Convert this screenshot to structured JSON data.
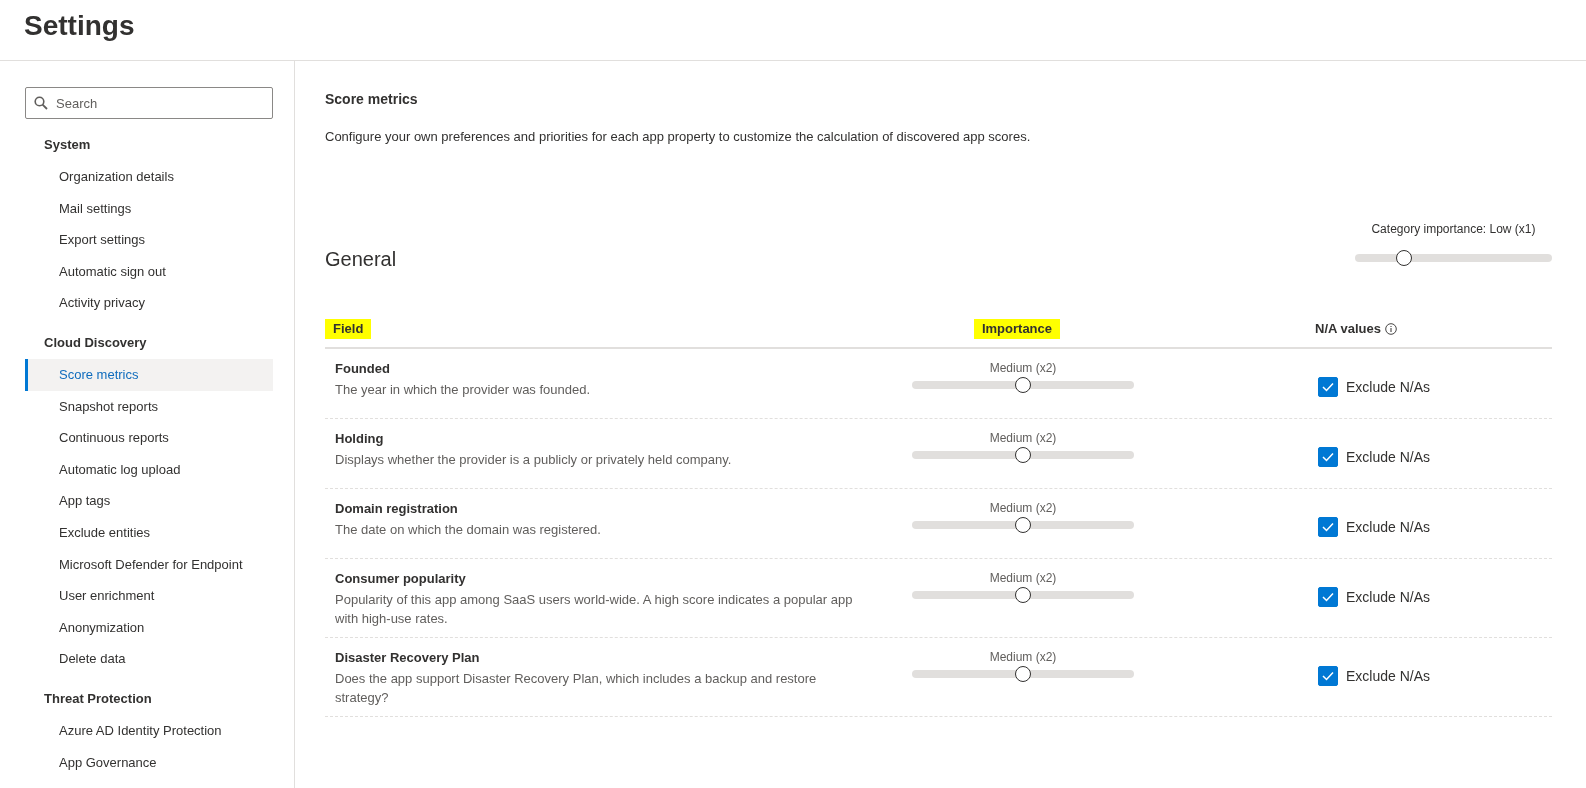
{
  "page": {
    "title": "Settings"
  },
  "sidebar": {
    "search": {
      "placeholder": "Search"
    },
    "groups": [
      {
        "heading": "System",
        "items": [
          {
            "label": "Organization details",
            "selected": false
          },
          {
            "label": "Mail settings",
            "selected": false
          },
          {
            "label": "Export settings",
            "selected": false
          },
          {
            "label": "Automatic sign out",
            "selected": false
          },
          {
            "label": "Activity privacy",
            "selected": false
          }
        ]
      },
      {
        "heading": "Cloud Discovery",
        "items": [
          {
            "label": "Score metrics",
            "selected": true
          },
          {
            "label": "Snapshot reports",
            "selected": false
          },
          {
            "label": "Continuous reports",
            "selected": false
          },
          {
            "label": "Automatic log upload",
            "selected": false
          },
          {
            "label": "App tags",
            "selected": false
          },
          {
            "label": "Exclude entities",
            "selected": false
          },
          {
            "label": "Microsoft Defender for Endpoint",
            "selected": false
          },
          {
            "label": "User enrichment",
            "selected": false
          },
          {
            "label": "Anonymization",
            "selected": false
          },
          {
            "label": "Delete data",
            "selected": false
          }
        ]
      },
      {
        "heading": "Threat Protection",
        "items": [
          {
            "label": "Azure AD Identity Protection",
            "selected": false
          },
          {
            "label": "App Governance",
            "selected": false
          }
        ]
      }
    ]
  },
  "content": {
    "title": "Score metrics",
    "description": "Configure your own preferences and priorities for each app property to customize the calculation of discovered app scores.",
    "category": {
      "title": "General",
      "importance_label": "Category importance: Low (x1)",
      "level": 0.25
    },
    "table": {
      "columns": [
        {
          "label": "Field",
          "highlighted": true
        },
        {
          "label": "Importance",
          "highlighted": true
        },
        {
          "label": "N/A values",
          "highlighted": false,
          "info": true
        }
      ],
      "rows": [
        {
          "name": "Founded",
          "description": "The year in which the provider was founded.",
          "importance": "Medium (x2)",
          "level": 0.5,
          "exclude_label": "Exclude N/As",
          "checked": true
        },
        {
          "name": "Holding",
          "description": "Displays whether the provider is a publicly or privately held company.",
          "importance": "Medium (x2)",
          "level": 0.5,
          "exclude_label": "Exclude N/As",
          "checked": true
        },
        {
          "name": "Domain registration",
          "description": "The date on which the domain was registered.",
          "importance": "Medium (x2)",
          "level": 0.5,
          "exclude_label": "Exclude N/As",
          "checked": true
        },
        {
          "name": "Consumer popularity",
          "description": "Popularity of this app among SaaS users world-wide. A high score indicates a popular app with high-use rates.",
          "importance": "Medium (x2)",
          "level": 0.5,
          "exclude_label": "Exclude N/As",
          "checked": true
        },
        {
          "name": "Disaster Recovery Plan",
          "description": "Does the app support Disaster Recovery Plan, which includes a backup and restore strategy?",
          "importance": "Medium (x2)",
          "level": 0.5,
          "exclude_label": "Exclude N/As",
          "checked": true
        }
      ]
    }
  }
}
